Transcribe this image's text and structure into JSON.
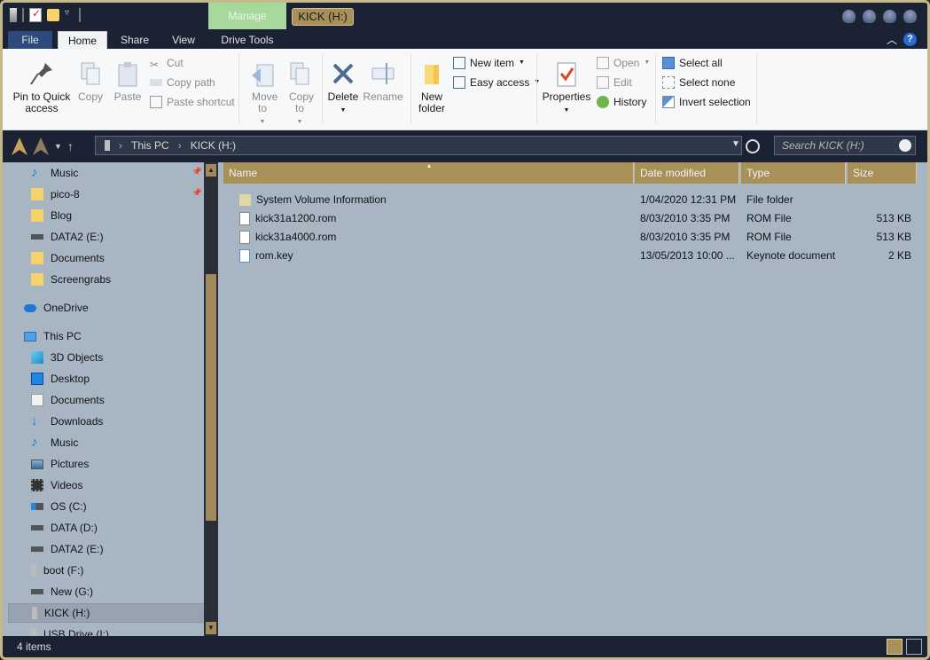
{
  "title_bar": {
    "manage_tab": "Manage",
    "window_title": "KICK (H:)"
  },
  "ribbon_tabs": [
    "File",
    "Home",
    "Share",
    "View",
    "Drive Tools"
  ],
  "ribbon": {
    "pin_to_quick_access": "Pin to Quick access",
    "copy": "Copy",
    "paste": "Paste",
    "cut": "Cut",
    "copy_path": "Copy path",
    "paste_shortcut": "Paste shortcut",
    "move_to": "Move to",
    "copy_to": "Copy to",
    "delete": "Delete",
    "rename": "Rename",
    "new_folder": "New folder",
    "new_item": "New item",
    "easy_access": "Easy access",
    "properties": "Properties",
    "open": "Open",
    "edit": "Edit",
    "history": "History",
    "select_all": "Select all",
    "select_none": "Select none",
    "invert_selection": "Invert selection"
  },
  "address": {
    "path": [
      "This PC",
      "KICK (H:)"
    ],
    "search_placeholder": "Search KICK (H:)"
  },
  "nav": {
    "quick_items": [
      "Music",
      "pico-8",
      "Blog",
      "DATA2 (E:)",
      "Documents",
      "Screengrabs"
    ],
    "onedrive": "OneDrive",
    "this_pc": "This PC",
    "pc_items": [
      "3D Objects",
      "Desktop",
      "Documents",
      "Downloads",
      "Music",
      "Pictures",
      "Videos",
      "OS (C:)",
      "DATA (D:)",
      "DATA2 (E:)",
      "boot (F:)",
      "New (G:)",
      "KICK (H:)",
      "USB Drive (I:)"
    ]
  },
  "columns": [
    "Name",
    "Date modified",
    "Type",
    "Size"
  ],
  "files": [
    {
      "name": "System Volume Information",
      "date": "1/04/2020 12:31 PM",
      "type": "File folder",
      "size": ""
    },
    {
      "name": "kick31a1200.rom",
      "date": "8/03/2010 3:35 PM",
      "type": "ROM File",
      "size": "513 KB"
    },
    {
      "name": "kick31a4000.rom",
      "date": "8/03/2010 3:35 PM",
      "type": "ROM File",
      "size": "513 KB"
    },
    {
      "name": "rom.key",
      "date": "13/05/2013 10:00 ...",
      "type": "Keynote document",
      "size": "2 KB"
    }
  ],
  "status": {
    "item_count": "4 items"
  },
  "colors": {
    "accent_gold": "#a98f58",
    "frame": "#1b2233",
    "pane": "#a8b6c4",
    "manage_green": "#a6d99b"
  }
}
